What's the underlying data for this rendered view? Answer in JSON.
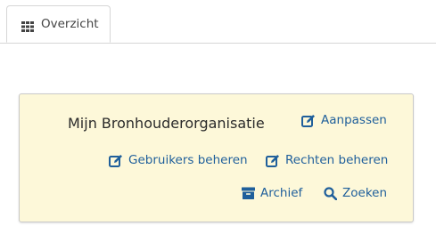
{
  "tabs": [
    {
      "label": "Overzicht",
      "icon": "grid-icon",
      "active": true
    }
  ],
  "panel": {
    "title": "Mijn Bronhouderorganisatie",
    "actions": {
      "aanpassen": {
        "label": "Aanpassen",
        "icon": "edit-icon"
      },
      "gebruikers": {
        "label": "Gebruikers beheren",
        "icon": "edit-icon"
      },
      "rechten": {
        "label": "Rechten beheren",
        "icon": "edit-icon"
      },
      "archief": {
        "label": "Archief",
        "icon": "archive-icon"
      },
      "zoeken": {
        "label": "Zoeken",
        "icon": "search-icon"
      }
    }
  },
  "colors": {
    "panel_background": "#fdf8d9",
    "link": "#1f5f9b",
    "tab_border": "#d6d6d6"
  }
}
